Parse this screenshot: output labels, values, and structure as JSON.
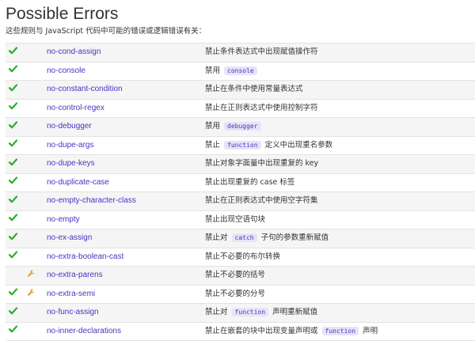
{
  "page": {
    "title": "Possible Errors",
    "subtitle": "这些规则与 JavaScript 代码中可能的错误或逻辑错误有关："
  },
  "colors": {
    "check": "#2cab2c",
    "fixable": "#e8a03c",
    "link": "#4b32c3",
    "code_bg": "#e6e4f7",
    "stripe": "#f5f5f5"
  },
  "icons": {
    "recommended": "check-icon",
    "fixable": "wrench-icon"
  },
  "rules": [
    {
      "name": "no-cond-assign",
      "recommended": true,
      "fixable": false,
      "desc": [
        {
          "t": "禁止条件表达式中出现赋值操作符"
        }
      ]
    },
    {
      "name": "no-console",
      "recommended": true,
      "fixable": false,
      "desc": [
        {
          "t": "禁用 "
        },
        {
          "code": "console"
        }
      ]
    },
    {
      "name": "no-constant-condition",
      "recommended": true,
      "fixable": false,
      "desc": [
        {
          "t": "禁止在条件中使用常量表达式"
        }
      ]
    },
    {
      "name": "no-control-regex",
      "recommended": true,
      "fixable": false,
      "desc": [
        {
          "t": "禁止在正则表达式中使用控制字符"
        }
      ]
    },
    {
      "name": "no-debugger",
      "recommended": true,
      "fixable": false,
      "desc": [
        {
          "t": "禁用 "
        },
        {
          "code": "debugger"
        }
      ]
    },
    {
      "name": "no-dupe-args",
      "recommended": true,
      "fixable": false,
      "desc": [
        {
          "t": "禁止 "
        },
        {
          "code": "function"
        },
        {
          "t": " 定义中出现重名参数"
        }
      ]
    },
    {
      "name": "no-dupe-keys",
      "recommended": true,
      "fixable": false,
      "desc": [
        {
          "t": "禁止对象字面量中出现重复的 key"
        }
      ]
    },
    {
      "name": "no-duplicate-case",
      "recommended": true,
      "fixable": false,
      "desc": [
        {
          "t": "禁止出现重复的 case 标签"
        }
      ]
    },
    {
      "name": "no-empty-character-class",
      "recommended": true,
      "fixable": false,
      "desc": [
        {
          "t": "禁止在正则表达式中使用空字符集"
        }
      ]
    },
    {
      "name": "no-empty",
      "recommended": true,
      "fixable": false,
      "desc": [
        {
          "t": "禁止出现空语句块"
        }
      ]
    },
    {
      "name": "no-ex-assign",
      "recommended": true,
      "fixable": false,
      "desc": [
        {
          "t": "禁止对 "
        },
        {
          "code": "catch"
        },
        {
          "t": " 子句的参数重新赋值"
        }
      ]
    },
    {
      "name": "no-extra-boolean-cast",
      "recommended": true,
      "fixable": false,
      "desc": [
        {
          "t": "禁止不必要的布尔转换"
        }
      ]
    },
    {
      "name": "no-extra-parens",
      "recommended": false,
      "fixable": true,
      "desc": [
        {
          "t": "禁止不必要的括号"
        }
      ]
    },
    {
      "name": "no-extra-semi",
      "recommended": true,
      "fixable": true,
      "desc": [
        {
          "t": "禁止不必要的分号"
        }
      ]
    },
    {
      "name": "no-func-assign",
      "recommended": true,
      "fixable": false,
      "desc": [
        {
          "t": "禁止对 "
        },
        {
          "code": "function"
        },
        {
          "t": " 声明重新赋值"
        }
      ]
    },
    {
      "name": "no-inner-declarations",
      "recommended": true,
      "fixable": false,
      "desc": [
        {
          "t": "禁止在嵌套的块中出现变量声明或 "
        },
        {
          "code": "function"
        },
        {
          "t": " 声明"
        }
      ]
    }
  ]
}
